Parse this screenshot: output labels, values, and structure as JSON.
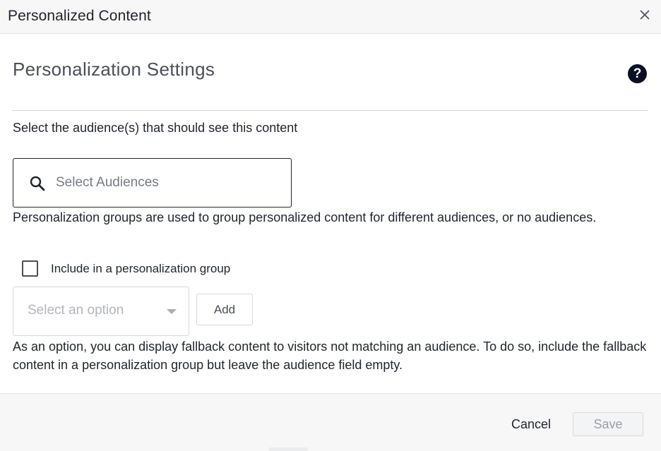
{
  "dialog": {
    "title": "Personalized Content",
    "close_icon": "close-icon"
  },
  "settings": {
    "title": "Personalization Settings",
    "help_icon": "help-icon",
    "help_glyph": "?"
  },
  "audience": {
    "label": "Select the audience(s) that should see this content",
    "placeholder": "Select Audiences",
    "icon": "search-icon"
  },
  "groups": {
    "description": "Personalization groups are used to group personalized content for different audiences, or no audiences.",
    "checkbox_label": "Include in a personalization group",
    "checked": false,
    "select_placeholder": "Select an option",
    "add_label": "Add"
  },
  "fallback": {
    "description": "As an option, you can display fallback content to visitors not matching an audience. To do so, include the fallback content in a personalization group but leave the audience field empty."
  },
  "footer": {
    "cancel_label": "Cancel",
    "save_label": "Save"
  },
  "colors": {
    "header_bg": "#f7f7f8",
    "text": "#1f2430",
    "help_icon_bg": "#0b0f24",
    "border": "#d6d8dc"
  }
}
